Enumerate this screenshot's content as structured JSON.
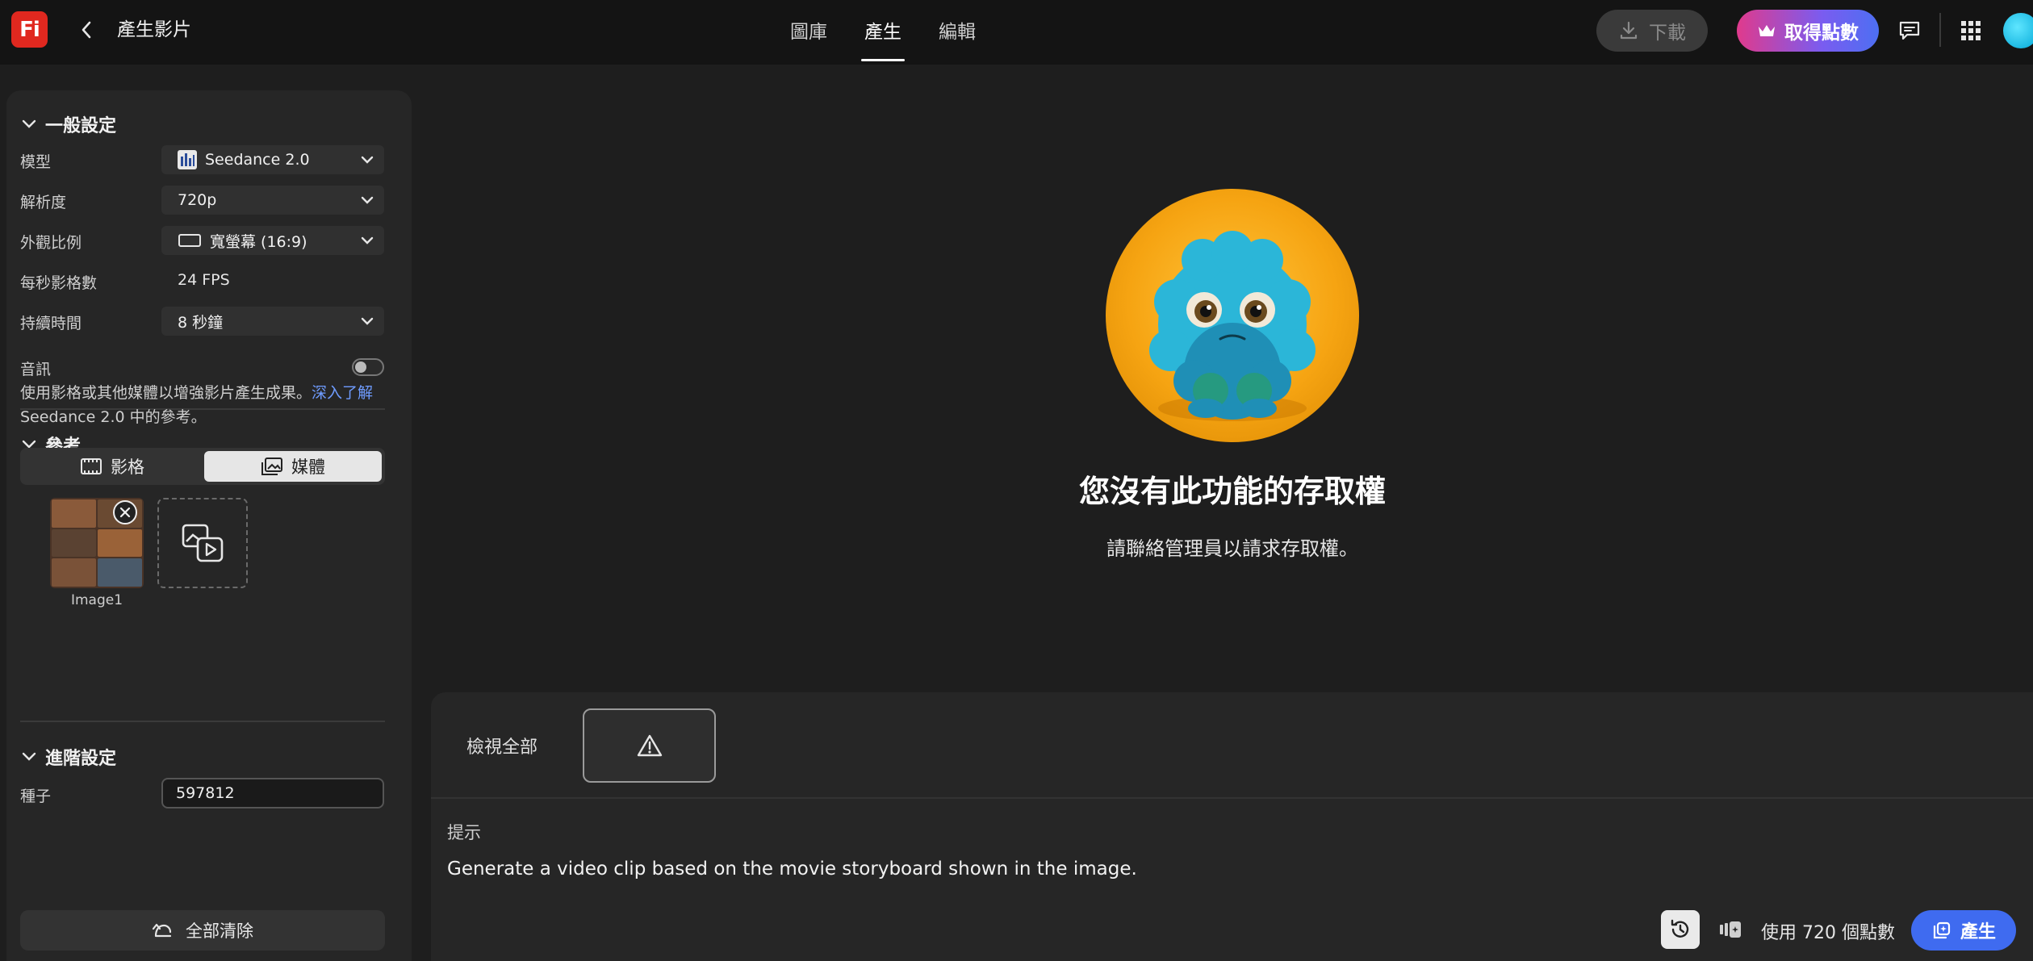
{
  "app": {
    "logo_text": "Fi",
    "page_title": "產生影片"
  },
  "nav": {
    "tabs": [
      {
        "label": "圖庫"
      },
      {
        "label": "產生"
      },
      {
        "label": "編輯"
      }
    ]
  },
  "header": {
    "download_label": "下載",
    "points_label": "取得點數"
  },
  "general": {
    "title": "一般設定",
    "model_label": "模型",
    "model_value": "Seedance 2.0",
    "resolution_label": "解析度",
    "resolution_value": "720p",
    "aspect_label": "外觀比例",
    "aspect_value": "寬螢幕 (16:9)",
    "fps_label": "每秒影格數",
    "fps_value": "24 FPS",
    "duration_label": "持續時間",
    "duration_value": "8 秒鐘",
    "audio_label": "音訊"
  },
  "reference": {
    "title": "參考",
    "desc": "使用影格或其他媒體以增強影片產生成果。",
    "link": "深入了解",
    "desc2": "Seedance 2.0 中的參考。",
    "seg_frames": "影格",
    "seg_media": "媒體",
    "thumb_label": "Image1"
  },
  "advanced": {
    "title": "進階設定",
    "seed_label": "種子",
    "seed_value": "597812"
  },
  "clear_label": "全部清除",
  "main": {
    "error_title": "您沒有此功能的存取權",
    "error_sub": "請聯絡管理員以請求存取權。"
  },
  "bottom": {
    "view_all": "檢視全部",
    "prompt_label": "提示",
    "prompt_text": "Generate a video clip based on the movie storyboard shown in the image.",
    "credit_text": "使用 720 個點數",
    "generate_label": "產生"
  },
  "colors": {
    "accent": "#3f6bf0",
    "logo": "#e0281f",
    "link": "#6f9cff"
  }
}
